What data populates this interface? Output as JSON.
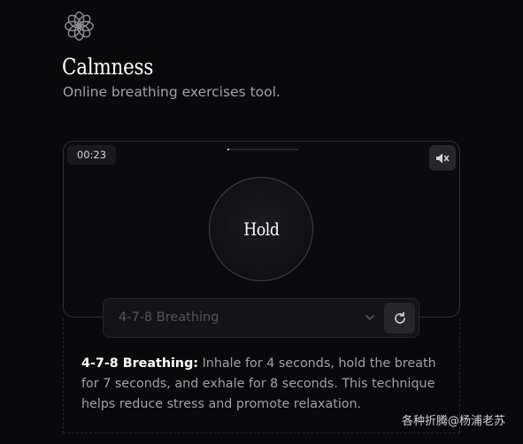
{
  "app": {
    "title": "Calmness",
    "subtitle": "Online breathing exercises tool.",
    "logo_icon": "flower-icon"
  },
  "player": {
    "timer": "00:23",
    "progress": 0.03,
    "phase": "Hold",
    "mute_icon": "speaker-muted-icon"
  },
  "controls": {
    "exercise_selected": "4-7-8 Breathing",
    "dropdown_icon": "chevron-down-icon",
    "reset_icon": "reset-icon"
  },
  "info": {
    "name": "4-7-8 Breathing:",
    "description": "Inhale for 4 seconds, hold the breath for 7 seconds, and exhale for 8 seconds. This technique helps reduce stress and promote relaxation."
  },
  "watermark": "各种折腾@杨浦老苏"
}
